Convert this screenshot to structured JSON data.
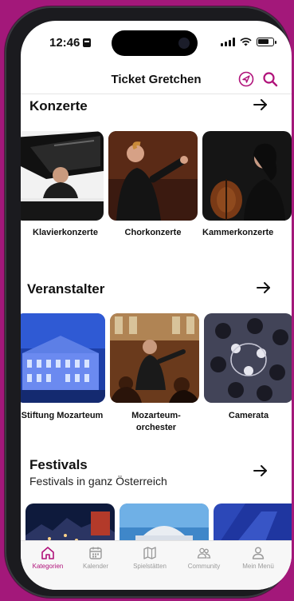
{
  "status_bar": {
    "time": "12:46"
  },
  "nav": {
    "title": "Ticket Gretchen"
  },
  "sections": {
    "konzerte": {
      "title": "Konzerte",
      "items": [
        {
          "label": "Klavierkonzerte"
        },
        {
          "label": "Chorkonzerte"
        },
        {
          "label": "Kammerkonzerte"
        }
      ]
    },
    "veranstalter": {
      "title": "Veranstalter",
      "items": [
        {
          "label": "Stiftung Mozarteum"
        },
        {
          "label_line1": "Mozarteum-",
          "label_line2": "orchester"
        },
        {
          "label": "Camerata"
        }
      ]
    },
    "festivals": {
      "title": "Festivals",
      "subtitle": "Festivals in ganz Österreich"
    }
  },
  "tabbar": {
    "tabs": [
      {
        "label": "Kategorien",
        "icon": "home-icon",
        "active": true
      },
      {
        "label": "Kalender",
        "icon": "calendar-icon",
        "active": false
      },
      {
        "label": "Spielstätten",
        "icon": "map-icon",
        "active": false
      },
      {
        "label": "Community",
        "icon": "community-icon",
        "active": false
      },
      {
        "label": "Mein Menü",
        "icon": "person-icon",
        "active": false
      }
    ]
  },
  "colors": {
    "accent": "#b0127a",
    "background": "#a3187a"
  }
}
